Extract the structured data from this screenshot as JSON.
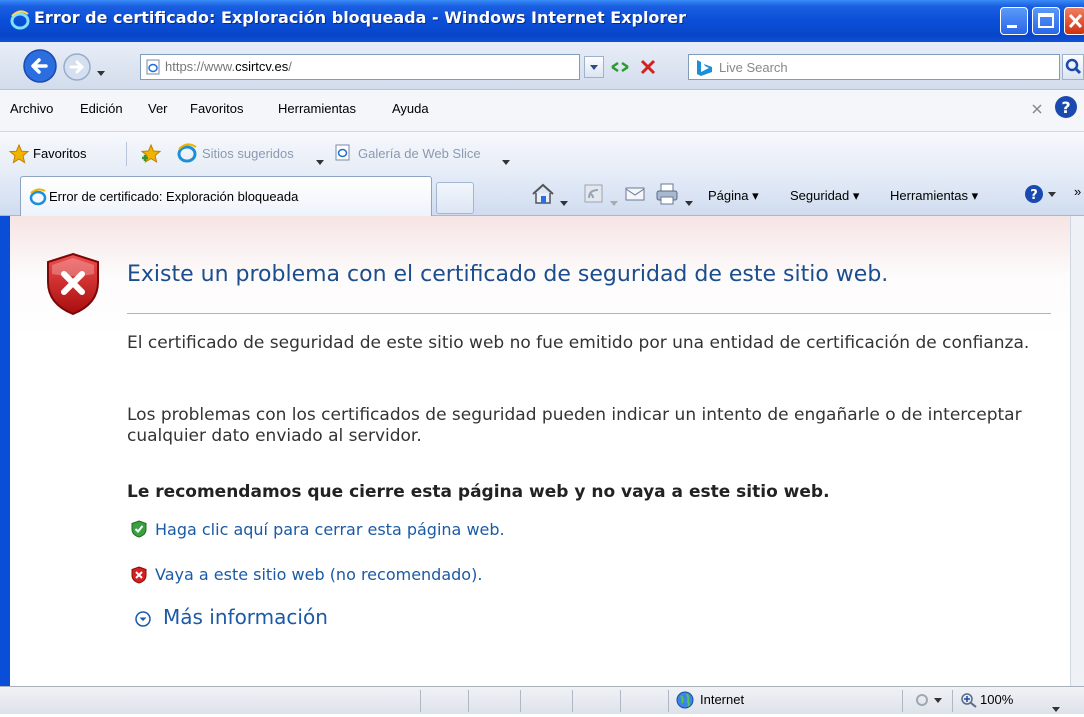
{
  "window": {
    "title": "Error de certificado: Exploración bloqueada - Windows Internet Explorer"
  },
  "address": {
    "url_prefix": "https://www.",
    "url_domain": "csirtcv.es",
    "url_suffix": "/",
    "search_placeholder": "Live Search"
  },
  "menu": {
    "items": [
      "Archivo",
      "Edición",
      "Ver",
      "Favoritos",
      "Herramientas",
      "Ayuda"
    ]
  },
  "favorites": {
    "label": "Favoritos",
    "suggested": "Sitios sugeridos",
    "webslice": "Galería de Web Slice"
  },
  "tab": {
    "title": "Error de certificado: Exploración bloqueada"
  },
  "commandbar": {
    "page": "Página",
    "security": "Seguridad",
    "tools": "Herramientas"
  },
  "content": {
    "heading": "Existe un problema con el certificado de seguridad de este sitio web.",
    "para1": "El certificado de seguridad de este sitio web no fue emitido por una entidad de certificación de confianza.",
    "para2": "Los problemas con los certificados de seguridad pueden indicar un intento de engañarle o de interceptar cualquier dato enviado al servidor.",
    "recommendation": "Le recomendamos que cierre esta página web y no vaya a este sitio web.",
    "close_link": "Haga clic aquí para cerrar esta página web.",
    "continue_link": "Vaya a este sitio web (no recomendado).",
    "more_info": "Más información"
  },
  "status": {
    "zone": "Internet",
    "zoom": "100%"
  },
  "colors": {
    "titlebar": "#0a4ed8",
    "heading": "#1c4d8c",
    "link": "#1b5aa6",
    "shield_red": "#d42020",
    "check_green": "#3aa040"
  },
  "icons": [
    "ie-logo-icon",
    "back-icon",
    "forward-icon",
    "refresh-icon",
    "stop-icon",
    "bing-icon",
    "search-icon",
    "favorites-star-icon",
    "add-favorites-icon",
    "home-icon",
    "rss-icon",
    "mail-icon",
    "print-icon",
    "help-icon",
    "shield-error-icon",
    "green-check-icon",
    "red-x-icon",
    "expand-circle-icon",
    "globe-icon",
    "zoom-icon"
  ]
}
